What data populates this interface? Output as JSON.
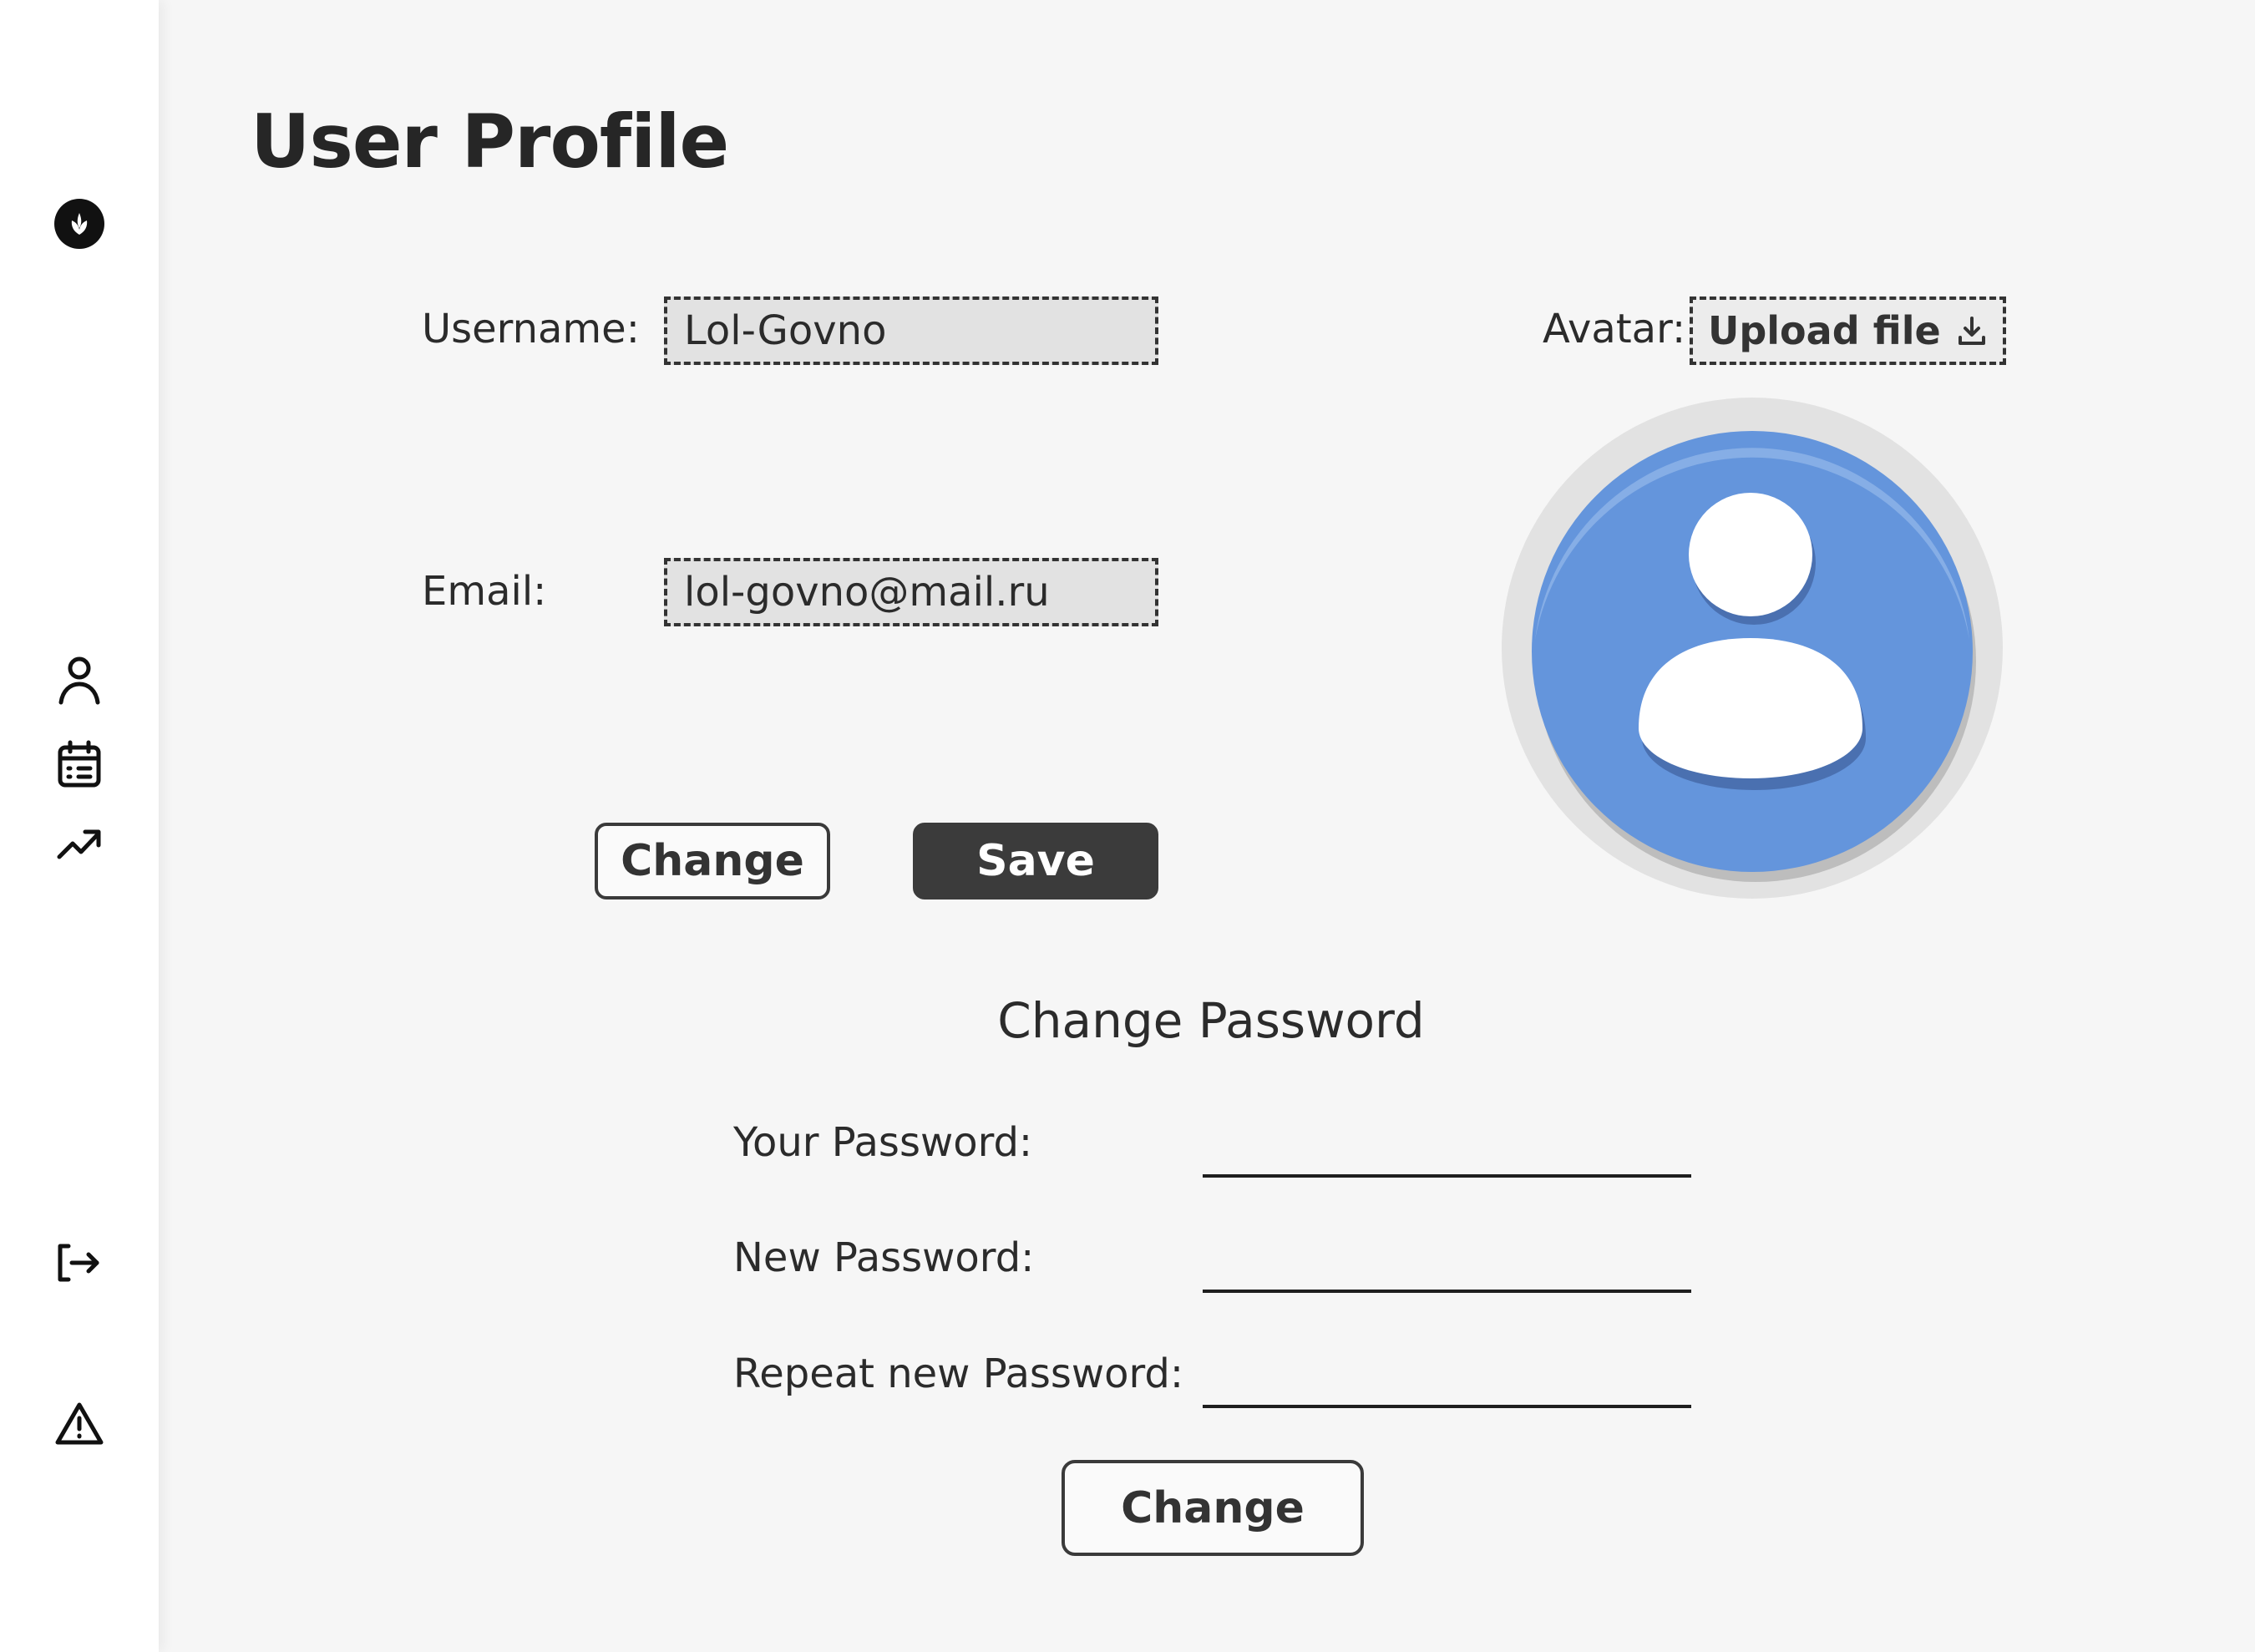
{
  "sidebar": {
    "logo_icon": "leaf-logo-icon",
    "items": [
      {
        "name": "profile",
        "icon": "user-icon"
      },
      {
        "name": "calendar",
        "icon": "calendar-icon"
      },
      {
        "name": "stats",
        "icon": "trending-up-icon"
      }
    ],
    "logout_icon": "logout-icon",
    "report_icon": "warning-icon"
  },
  "page": {
    "title": "User Profile"
  },
  "profile": {
    "username_label": "Username:",
    "username_value": "Lol-Govno",
    "email_label": "Email:",
    "email_value": "lol-govno@mail.ru",
    "change_label": "Change",
    "save_label": "Save",
    "avatar_label": "Avatar:",
    "upload_label": "Upload file"
  },
  "password": {
    "title": "Change Password",
    "current_label": "Your Password:",
    "new_label": "New Password:",
    "repeat_label": "Repeat new Password:",
    "change_label": "Change"
  },
  "colors": {
    "accent_dark": "#3b3b3b",
    "avatar_blue": "#6495dc",
    "background": "#f6f6f6"
  }
}
